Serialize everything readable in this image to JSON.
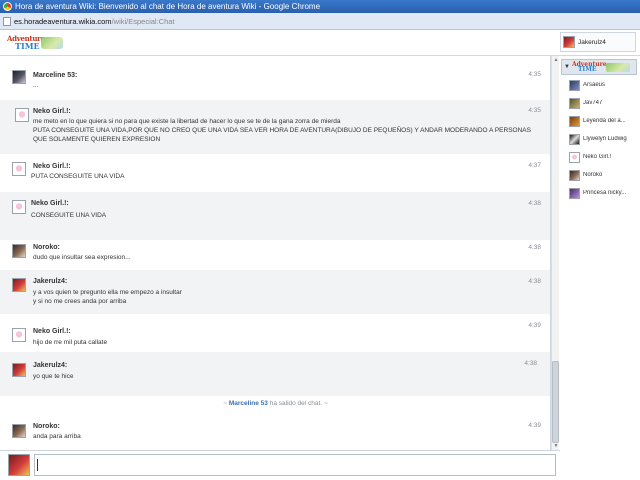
{
  "window": {
    "title": "Hora de aventura Wiki: Bienvenido al chat de Hora de aventura Wiki - Google Chrome",
    "url_domain": "es.horadeaventura.wikia.com",
    "url_path": "/wiki/Especial:Chat"
  },
  "header": {
    "logo_line1": "Adventure",
    "logo_line2": "TIME",
    "current_user": "Jakerulz4"
  },
  "messages": [
    {
      "user": "Marceline 53:",
      "avatar": "marceline-avatar",
      "time": "4:35",
      "lines": [
        "..."
      ]
    },
    {
      "user": "Neko Girl.!:",
      "avatar": "neko-avatar",
      "time": "4:35",
      "lines": [
        "me meto en lo que quiera si no para que existe la libertad de hacer lo que se te de la gana zorra de mierda",
        "PUTA CONSEGUITE UNA VIDA,POR QUE NO CREO QUE UNA VIDA SEA VER HORA DE AVENTURA(DIBUJO DE PEQUEÑOS) Y ANDAR MODERANDO A PERSONAS",
        "QUE SOLAMENTE QUIEREN EXPRESION"
      ]
    },
    {
      "user": "Neko Girl.!:",
      "avatar": "neko-avatar",
      "time": "4:37",
      "lines": [
        "PUTA CONSEGUITE UNA VIDA"
      ]
    },
    {
      "user": "Neko Girl.!:",
      "avatar": "neko-avatar",
      "time": "4:38",
      "lines": [
        "CONSEGUITE UNA VIDA"
      ]
    },
    {
      "user": "Noroko:",
      "avatar": "noroko-avatar",
      "time": "4:38",
      "lines": [
        "dudo que insultar sea expresion..."
      ]
    },
    {
      "user": "Jakerulz4:",
      "avatar": "jake-avatar",
      "time": "4:38",
      "lines": [
        "y a vos quien te pregunto ella me empezo a insultar",
        "y si no me crees anda por arriba"
      ]
    },
    {
      "user": "Neko Girl.!:",
      "avatar": "neko-avatar",
      "time": "4:39",
      "lines": [
        "hijo de rre mil puta callate"
      ]
    },
    {
      "user": "Jakerulz4:",
      "avatar": "jake-avatar",
      "time": "4:38",
      "lines": [
        "yo que te hice"
      ]
    },
    {
      "user": "Noroko:",
      "avatar": "noroko-avatar",
      "time": "4:39",
      "lines": [
        "anda para arriba"
      ]
    }
  ],
  "status": {
    "prefix": "~",
    "user": "Marceline 53",
    "text": "ha salido del chat.",
    "suffix": "~"
  },
  "userlist": {
    "users": [
      {
        "name": "Arsaeus",
        "avatar": "arsaeus-avatar"
      },
      {
        "name": "Jav747",
        "avatar": "jav-avatar"
      },
      {
        "name": "Leyenda del a...",
        "avatar": "leyenda-avatar"
      },
      {
        "name": "Llywelyn Ludwig",
        "avatar": "llywelyn-avatar"
      },
      {
        "name": "Neko Girl.!",
        "avatar": "neko-avatar"
      },
      {
        "name": "Noroko",
        "avatar": "noroko-avatar"
      },
      {
        "name": "Princesa nicky...",
        "avatar": "princesa-avatar"
      }
    ]
  },
  "composer": {
    "value": ""
  }
}
